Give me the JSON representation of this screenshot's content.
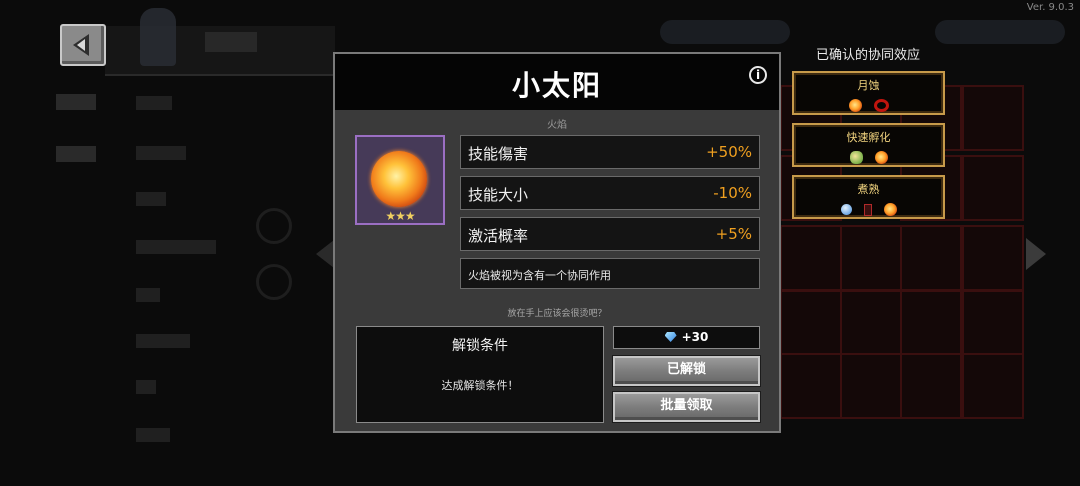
{
  "version": "Ver. 9.0.3",
  "dialog": {
    "title": "小太阳",
    "subtitle": "火焰",
    "item_stars": "★★★",
    "stats": [
      {
        "name": "技能傷害",
        "value": "+50%"
      },
      {
        "name": "技能大小",
        "value": "-10%"
      },
      {
        "name": "激活概率",
        "value": "+5%"
      }
    ],
    "description": "火焰被视为含有一个协同作用",
    "flavor_text": "放在手上应该会很烫吧？",
    "unlock": {
      "title": "解锁条件",
      "status": "达成解锁条件！"
    },
    "reward": "+30",
    "buttons": {
      "unlocked": "已解锁",
      "batch_claim": "批量领取"
    }
  },
  "synergy_panel": {
    "header": "已确认的协同效应",
    "items": [
      {
        "name": "月蚀",
        "icons": [
          "fire-orb-icon",
          "red-ring-icon"
        ]
      },
      {
        "name": "快速孵化",
        "icons": [
          "egg-icon",
          "fire-orb-icon"
        ]
      },
      {
        "name": "煮熟",
        "icons": [
          "apple-icon",
          "meat-icon",
          "fire-orb-icon"
        ]
      }
    ]
  },
  "colors": {
    "stat_value": "#f0a020",
    "rarity_border": "#9b6fc3",
    "synergy_border": "#c79a4a"
  }
}
